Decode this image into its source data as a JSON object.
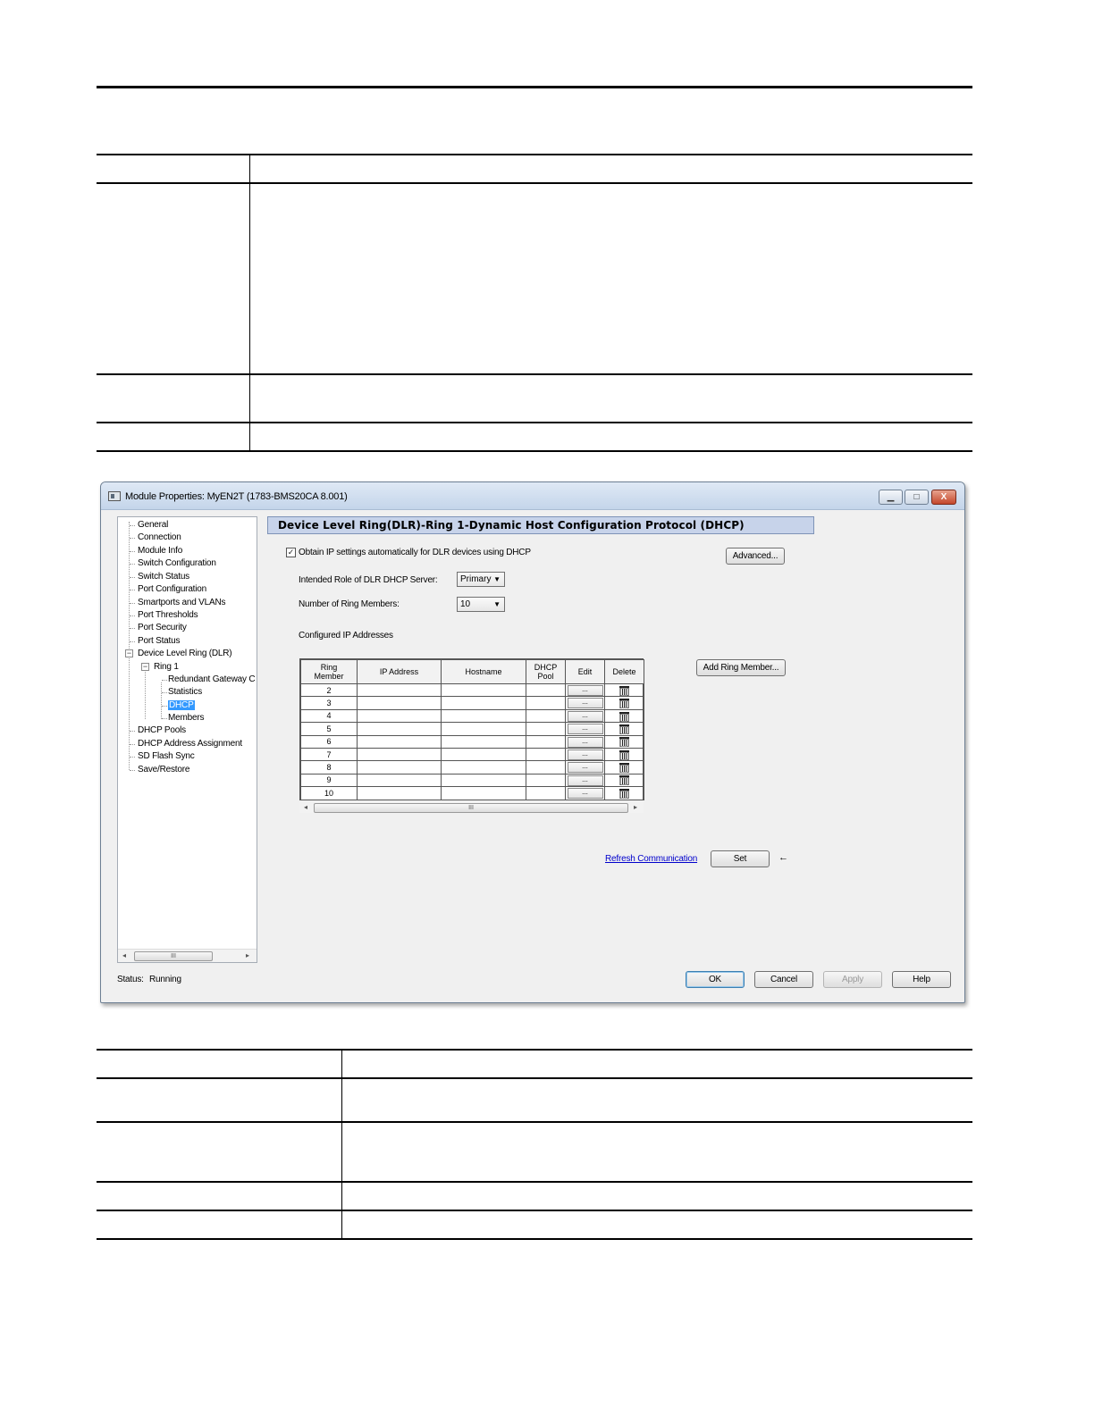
{
  "dialog": {
    "title": "Module Properties: MyEN2T (1783-BMS20CA 8.001)",
    "window_buttons": {
      "minimize": "▁",
      "maximize": "□",
      "close": "X"
    },
    "tree": {
      "items": [
        {
          "label": "General"
        },
        {
          "label": "Connection"
        },
        {
          "label": "Module Info"
        },
        {
          "label": "Switch Configuration"
        },
        {
          "label": "Switch Status"
        },
        {
          "label": "Port Configuration"
        },
        {
          "label": "Smartports and VLANs"
        },
        {
          "label": "Port Thresholds"
        },
        {
          "label": "Port Security"
        },
        {
          "label": "Port Status"
        },
        {
          "label": "Device Level Ring (DLR)"
        },
        {
          "label": "Ring 1"
        },
        {
          "label": "Redundant Gateway C"
        },
        {
          "label": "Statistics"
        },
        {
          "label": "DHCP"
        },
        {
          "label": "Members"
        },
        {
          "label": "DHCP Pools"
        },
        {
          "label": "DHCP Address Assignment"
        },
        {
          "label": "SD Flash Sync"
        },
        {
          "label": "Save/Restore"
        }
      ],
      "expander_minus": "−",
      "scroll_left": "◂",
      "scroll_right": "▸",
      "scroll_thumb": "III"
    },
    "section_title": "Device Level Ring(DLR)-Ring 1-Dynamic Host Configuration Protocol (DHCP)",
    "obtain_ip": {
      "checked": "✓",
      "label": "Obtain IP settings automatically for DLR devices using DHCP"
    },
    "advanced_button": "Advanced...",
    "intended_role": {
      "label": "Intended Role of DLR DHCP Server:",
      "value": "Primary"
    },
    "ring_members": {
      "label": "Number of Ring Members:",
      "value": "10"
    },
    "dropdown_arrow": "▼",
    "configured_label": "Configured IP Addresses",
    "add_ring_member_button": "Add Ring Member...",
    "grid": {
      "headers": {
        "ring_member_1": "Ring",
        "ring_member_2": "Member",
        "ip_address": "IP Address",
        "hostname": "Hostname",
        "dhcp_pool_1": "DHCP",
        "dhcp_pool_2": "Pool",
        "edit": "Edit",
        "delete": "Delete"
      },
      "rows": [
        "2",
        "3",
        "4",
        "5",
        "6",
        "7",
        "8",
        "9",
        "10"
      ],
      "edit_label": "...",
      "scroll_left": "◂",
      "scroll_right": "▸",
      "scroll_thumb": "III"
    },
    "refresh_link": "Refresh Communication",
    "set_button": "Set",
    "set_arrow": "←",
    "status": {
      "label": "Status:",
      "value": "Running"
    },
    "buttons": {
      "ok": "OK",
      "cancel": "Cancel",
      "apply": "Apply",
      "help": "Help"
    }
  }
}
